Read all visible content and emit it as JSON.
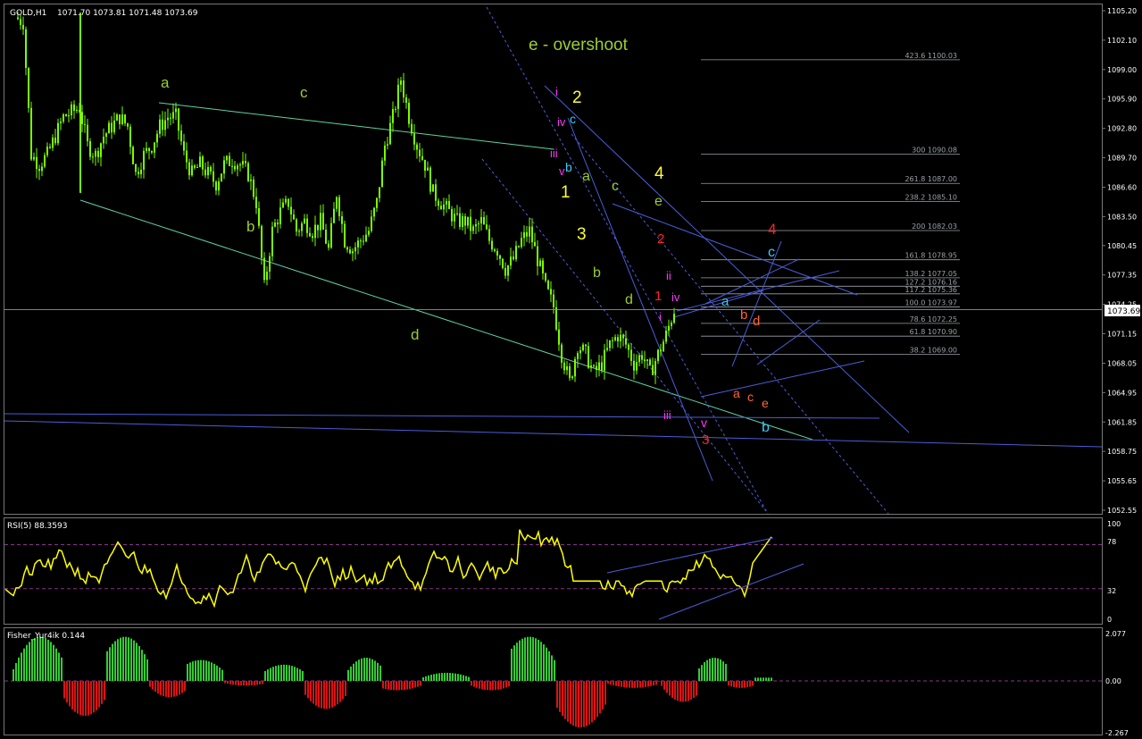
{
  "window": {
    "symbol_title": "GOLD,H1",
    "ohlc": "1071.70 1073.81 1071.48 1073.69",
    "current_price": "1073.69"
  },
  "colors": {
    "background": "#000000",
    "candle": "#7CFC00",
    "trendline_green": "#5fd3a3",
    "trendline_blue": "#4b5dd8",
    "fib": "#9aa0a6",
    "wave_green": "#9acd32",
    "wave_yellow": "#ffff33",
    "wave_magenta": "#ff33ff",
    "wave_cyan": "#33ccff",
    "wave_red": "#ff2222",
    "wave_orange": "#ff6633",
    "rsi_line": "#ffff00",
    "hist_pos": "#33cc33",
    "hist_neg": "#dd1111",
    "grid_dash": "#883388"
  },
  "main_axis": {
    "ticks": [
      "1105.20",
      "1102.10",
      "1099.00",
      "1095.90",
      "1092.80",
      "1089.70",
      "1086.60",
      "1083.50",
      "1080.45",
      "1077.35",
      "1074.25",
      "1071.15",
      "1068.05",
      "1064.95",
      "1061.85",
      "1058.75",
      "1055.65",
      "1052.55"
    ]
  },
  "chart_data": [
    {
      "type": "candlestick",
      "title": "GOLD,H1",
      "ohlc_label": "1071.70 1073.81 1071.48 1073.69",
      "ylim": [
        1052.55,
        1105.2
      ],
      "y_ticks": [
        1105.2,
        1102.1,
        1099.0,
        1095.9,
        1092.8,
        1089.7,
        1086.6,
        1083.5,
        1080.45,
        1077.35,
        1074.25,
        1071.15,
        1068.05,
        1064.95,
        1061.85,
        1058.75,
        1055.65,
        1052.55
      ],
      "last_price": 1073.69,
      "approx_close_path": [
        1104.5,
        1104,
        1090,
        1089,
        1090,
        1092,
        1094,
        1094.5,
        1095,
        1091,
        1090,
        1092,
        1093,
        1094,
        1093,
        1088,
        1090,
        1091,
        1093,
        1094,
        1094,
        1090,
        1088,
        1089,
        1088,
        1087,
        1089,
        1089.5,
        1089,
        1088,
        1085,
        1076,
        1082,
        1084,
        1085,
        1082,
        1083,
        1082,
        1083,
        1080,
        1086,
        1081,
        1080,
        1081,
        1082,
        1085,
        1091,
        1094,
        1098,
        1094,
        1091,
        1089,
        1086,
        1085,
        1084,
        1083,
        1083,
        1082,
        1083,
        1081,
        1080,
        1078,
        1079,
        1081,
        1082,
        1079,
        1076,
        1074,
        1069,
        1066,
        1070,
        1069,
        1067,
        1068,
        1070,
        1071,
        1070,
        1068,
        1069,
        1067,
        1069,
        1071,
        1073.69
      ],
      "fibonacci_levels": [
        {
          "ratio": "423.6",
          "price": "1100.03"
        },
        {
          "ratio": "300",
          "price": "1090.08"
        },
        {
          "ratio": "261.8",
          "price": "1087.00"
        },
        {
          "ratio": "238.2",
          "price": "1085.10"
        },
        {
          "ratio": "200",
          "price": "1082.03"
        },
        {
          "ratio": "161.8",
          "price": "1078.95"
        },
        {
          "ratio": "138.2",
          "price": "1077.05"
        },
        {
          "ratio": "127.2",
          "price": "1076.16"
        },
        {
          "ratio": "117.2",
          "price": "1075.36"
        },
        {
          "ratio": "100.0",
          "price": "1073.97"
        },
        {
          "ratio": "78.6",
          "price": "1072.25"
        },
        {
          "ratio": "61.8",
          "price": "1070.90"
        },
        {
          "ratio": "38.2",
          "price": "1069.00"
        }
      ],
      "annotations": [
        "e - overshoot",
        "a",
        "b",
        "c",
        "d",
        "i",
        "ii",
        "iii",
        "iv",
        "v",
        "1",
        "2",
        "3",
        "4",
        "e"
      ]
    },
    {
      "type": "line",
      "title": "RSI(5) 88.3593",
      "ylim": [
        0,
        100
      ],
      "y_ticks": [
        100,
        78,
        32,
        0
      ],
      "levels": [
        78,
        32
      ],
      "last_value": 88.3593
    },
    {
      "type": "histogram",
      "title": "Fisher_Yur4ik 0.144",
      "ylim": [
        -2.267,
        2.077
      ],
      "y_ticks": [
        2.077,
        0.0,
        -2.267
      ],
      "last_value": 0.144
    }
  ],
  "rsi_panel": {
    "title": "RSI(5) 88.3593",
    "ticks": [
      "100",
      "78",
      "32",
      "0"
    ]
  },
  "fisher_panel": {
    "title": "Fisher_Yur4ik 0.144",
    "ticks": [
      "2.077",
      "0.00",
      "-2.267"
    ]
  },
  "wave_labels": [
    {
      "text": "e - overshoot",
      "color": "wave_green"
    },
    {
      "text": "a",
      "color": "wave_green"
    },
    {
      "text": "c",
      "color": "wave_green"
    },
    {
      "text": "b",
      "color": "wave_green"
    },
    {
      "text": "d",
      "color": "wave_green"
    },
    {
      "text": "2",
      "color": "wave_yellow"
    },
    {
      "text": "1",
      "color": "wave_yellow"
    },
    {
      "text": "3",
      "color": "wave_yellow"
    },
    {
      "text": "4",
      "color": "wave_yellow"
    },
    {
      "text": "i",
      "color": "wave_magenta"
    },
    {
      "text": "iv",
      "color": "wave_magenta"
    },
    {
      "text": "c",
      "color": "wave_cyan"
    },
    {
      "text": "iii",
      "color": "wave_magenta"
    },
    {
      "text": "b",
      "color": "wave_cyan"
    },
    {
      "text": "v",
      "color": "wave_magenta"
    },
    {
      "text": "a",
      "color": "wave_green"
    },
    {
      "text": "c",
      "color": "wave_green"
    },
    {
      "text": "b",
      "color": "wave_green"
    },
    {
      "text": "d",
      "color": "wave_green"
    },
    {
      "text": "e",
      "color": "wave_green"
    },
    {
      "text": "2",
      "color": "wave_red"
    },
    {
      "text": "ii",
      "color": "wave_magenta"
    },
    {
      "text": "1",
      "color": "wave_red"
    },
    {
      "text": "iv",
      "color": "wave_magenta"
    },
    {
      "text": "i",
      "color": "wave_magenta"
    },
    {
      "text": "4",
      "color": "wave_red"
    },
    {
      "text": "c",
      "color": "wave_cyan"
    },
    {
      "text": "a",
      "color": "wave_cyan"
    },
    {
      "text": "b",
      "color": "wave_orange"
    },
    {
      "text": "d",
      "color": "wave_orange"
    },
    {
      "text": "a",
      "color": "wave_orange"
    },
    {
      "text": "c",
      "color": "wave_orange"
    },
    {
      "text": "e",
      "color": "wave_orange"
    },
    {
      "text": "iii",
      "color": "wave_magenta"
    },
    {
      "text": "v",
      "color": "wave_magenta"
    },
    {
      "text": "3",
      "color": "wave_red"
    },
    {
      "text": "b",
      "color": "wave_cyan"
    }
  ]
}
